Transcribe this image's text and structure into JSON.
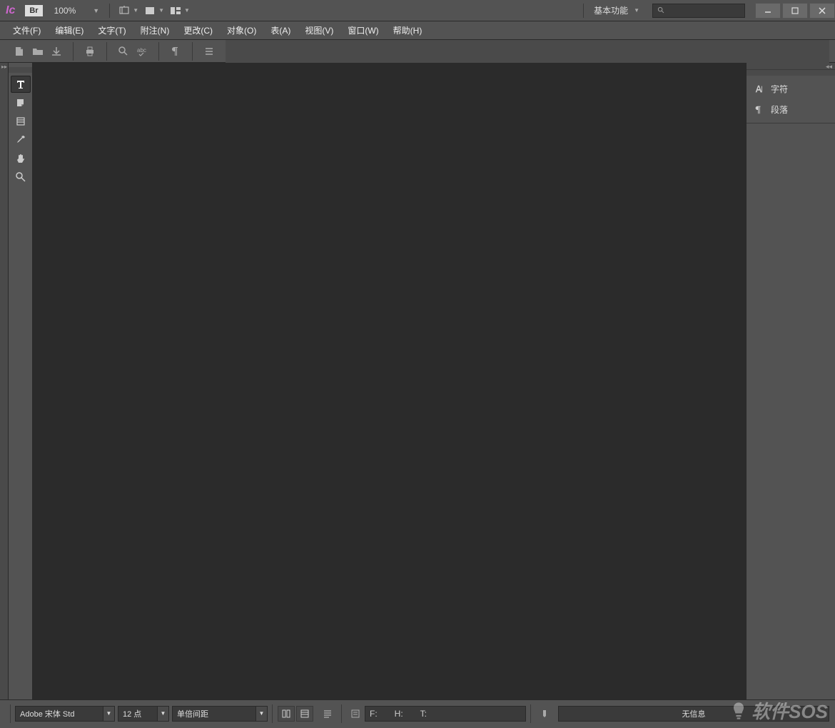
{
  "titlebar": {
    "logo": "Ic",
    "bridge": "Br",
    "zoom": "100%",
    "workspace": "基本功能"
  },
  "menu": {
    "items": [
      "文件(F)",
      "编辑(E)",
      "文字(T)",
      "附注(N)",
      "更改(C)",
      "对象(O)",
      "表(A)",
      "视图(V)",
      "窗口(W)",
      "帮助(H)"
    ]
  },
  "right_panel": {
    "items": [
      {
        "label": "字符"
      },
      {
        "label": "段落"
      }
    ]
  },
  "statusbar": {
    "font": "Adobe 宋体 Std",
    "size": "12 点",
    "spacing": "单倍间距",
    "f_label": "F:",
    "h_label": "H:",
    "t_label": "T:",
    "info": "无信息"
  },
  "watermark": "软件SOS"
}
